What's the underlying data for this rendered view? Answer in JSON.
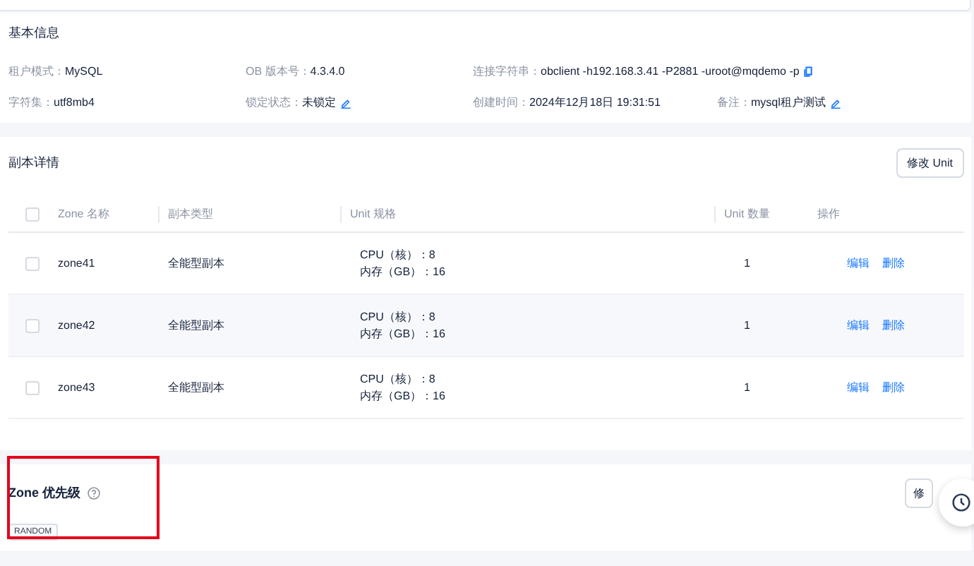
{
  "basic_info": {
    "title": "基本信息",
    "fields": [
      {
        "label": "租户模式：",
        "value": "MySQL"
      },
      {
        "label": "OB 版本号：",
        "value": "4.3.4.0"
      },
      {
        "label": "连接字符串：",
        "value": "obclient -h192.168.3.41 -P2881 -uroot@mqdemo -p",
        "copyable": true
      },
      {
        "label": "字符集：",
        "value": "utf8mb4"
      },
      {
        "label": "锁定状态：",
        "value": "未锁定",
        "editable": true
      },
      {
        "label": "创建时间：",
        "value": "2024年12月18日 19:31:51"
      },
      {
        "label": "备注：",
        "value": "mysql租户测试",
        "editable": true
      }
    ]
  },
  "replicas": {
    "title": "副本详情",
    "button": "修改 Unit",
    "table": {
      "all_checked": false,
      "columns": [
        "Zone 名称",
        "副本类型",
        "Unit 规格",
        "Unit 数量",
        "操作"
      ],
      "rows": [
        {
          "checked": false,
          "zone": "zone41",
          "type": "全能型副本",
          "spec": [
            "CPU（核）：8",
            "内存（GB）：16"
          ],
          "count": "1",
          "actions": [
            "编辑",
            "删除"
          ]
        },
        {
          "checked": false,
          "zone": "zone42",
          "type": "全能型副本",
          "spec": [
            "CPU（核）：8",
            "内存（GB）：16"
          ],
          "count": "1",
          "actions": [
            "编辑",
            "删除"
          ]
        },
        {
          "checked": false,
          "zone": "zone43",
          "type": "全能型副本",
          "spec": [
            "CPU（核）：8",
            "内存（GB）：16"
          ],
          "count": "1",
          "actions": [
            "编辑",
            "删除"
          ]
        }
      ]
    }
  },
  "zone_priority": {
    "title": "Zone 优先级",
    "tag": "RANDOM",
    "button": "修"
  }
}
